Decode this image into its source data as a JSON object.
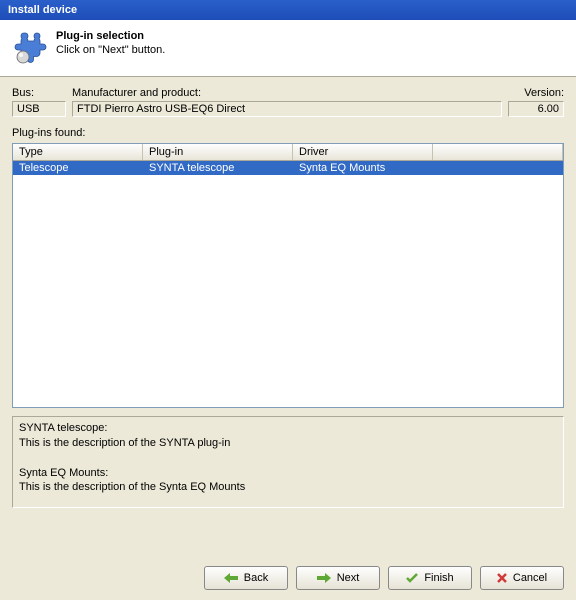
{
  "title": "Install device",
  "header": {
    "heading": "Plug-in selection",
    "subtext": "Click on \"Next\" button."
  },
  "info": {
    "bus_label": "Bus:",
    "manufacturer_label": "Manufacturer and product:",
    "version_label": "Version:",
    "bus_value": "USB",
    "manufacturer_value": "FTDI Pierro Astro USB-EQ6 Direct",
    "version_value": "6.00"
  },
  "plugins_found_label": "Plug-ins found:",
  "table": {
    "headers": {
      "type": "Type",
      "plugin": "Plug-in",
      "driver": "Driver"
    },
    "rows": [
      {
        "type": "Telescope",
        "plugin": "SYNTA telescope",
        "driver": "Synta EQ Mounts"
      }
    ]
  },
  "description": "SYNTA telescope:\nThis is the description of the SYNTA plug-in\n\nSynta EQ Mounts:\nThis is the description of the Synta EQ Mounts",
  "buttons": {
    "back": "Back",
    "next": "Next",
    "finish": "Finish",
    "cancel": "Cancel"
  }
}
